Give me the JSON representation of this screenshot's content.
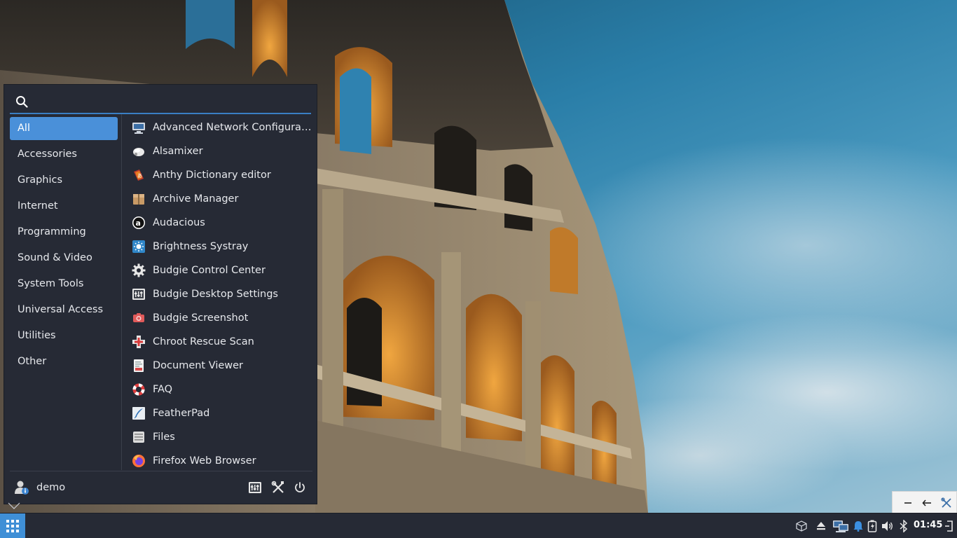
{
  "desktop": {
    "wallpaper": "colosseum-photo"
  },
  "menu": {
    "search": {
      "placeholder": "",
      "value": ""
    },
    "categories": [
      {
        "label": "All",
        "active": true
      },
      {
        "label": "Accessories"
      },
      {
        "label": "Graphics"
      },
      {
        "label": "Internet"
      },
      {
        "label": "Programming"
      },
      {
        "label": "Sound & Video"
      },
      {
        "label": "System Tools"
      },
      {
        "label": "Universal Access"
      },
      {
        "label": "Utilities"
      },
      {
        "label": "Other"
      }
    ],
    "apps": [
      {
        "label": "Advanced Network Configurat...",
        "icon": "network-config-icon"
      },
      {
        "label": "Alsamixer",
        "icon": "alsamixer-icon"
      },
      {
        "label": "Anthy Dictionary editor",
        "icon": "anthy-dictionary-icon"
      },
      {
        "label": "Archive Manager",
        "icon": "archive-manager-icon"
      },
      {
        "label": "Audacious",
        "icon": "audacious-icon"
      },
      {
        "label": "Brightness Systray",
        "icon": "brightness-icon"
      },
      {
        "label": "Budgie Control Center",
        "icon": "gear-icon"
      },
      {
        "label": "Budgie Desktop Settings",
        "icon": "desktop-settings-icon"
      },
      {
        "label": "Budgie Screenshot",
        "icon": "camera-icon"
      },
      {
        "label": "Chroot Rescue Scan",
        "icon": "rescue-icon"
      },
      {
        "label": "Document Viewer",
        "icon": "document-viewer-icon"
      },
      {
        "label": "FAQ",
        "icon": "lifebuoy-icon"
      },
      {
        "label": "FeatherPad",
        "icon": "featherpad-icon"
      },
      {
        "label": "Files",
        "icon": "files-icon"
      },
      {
        "label": "Firefox Web Browser",
        "icon": "firefox-icon"
      }
    ],
    "user": {
      "name": "demo"
    },
    "accent": "#4a90d9"
  },
  "panel": {
    "clock": "01:45",
    "launcher_color": "#3f8fd6"
  }
}
